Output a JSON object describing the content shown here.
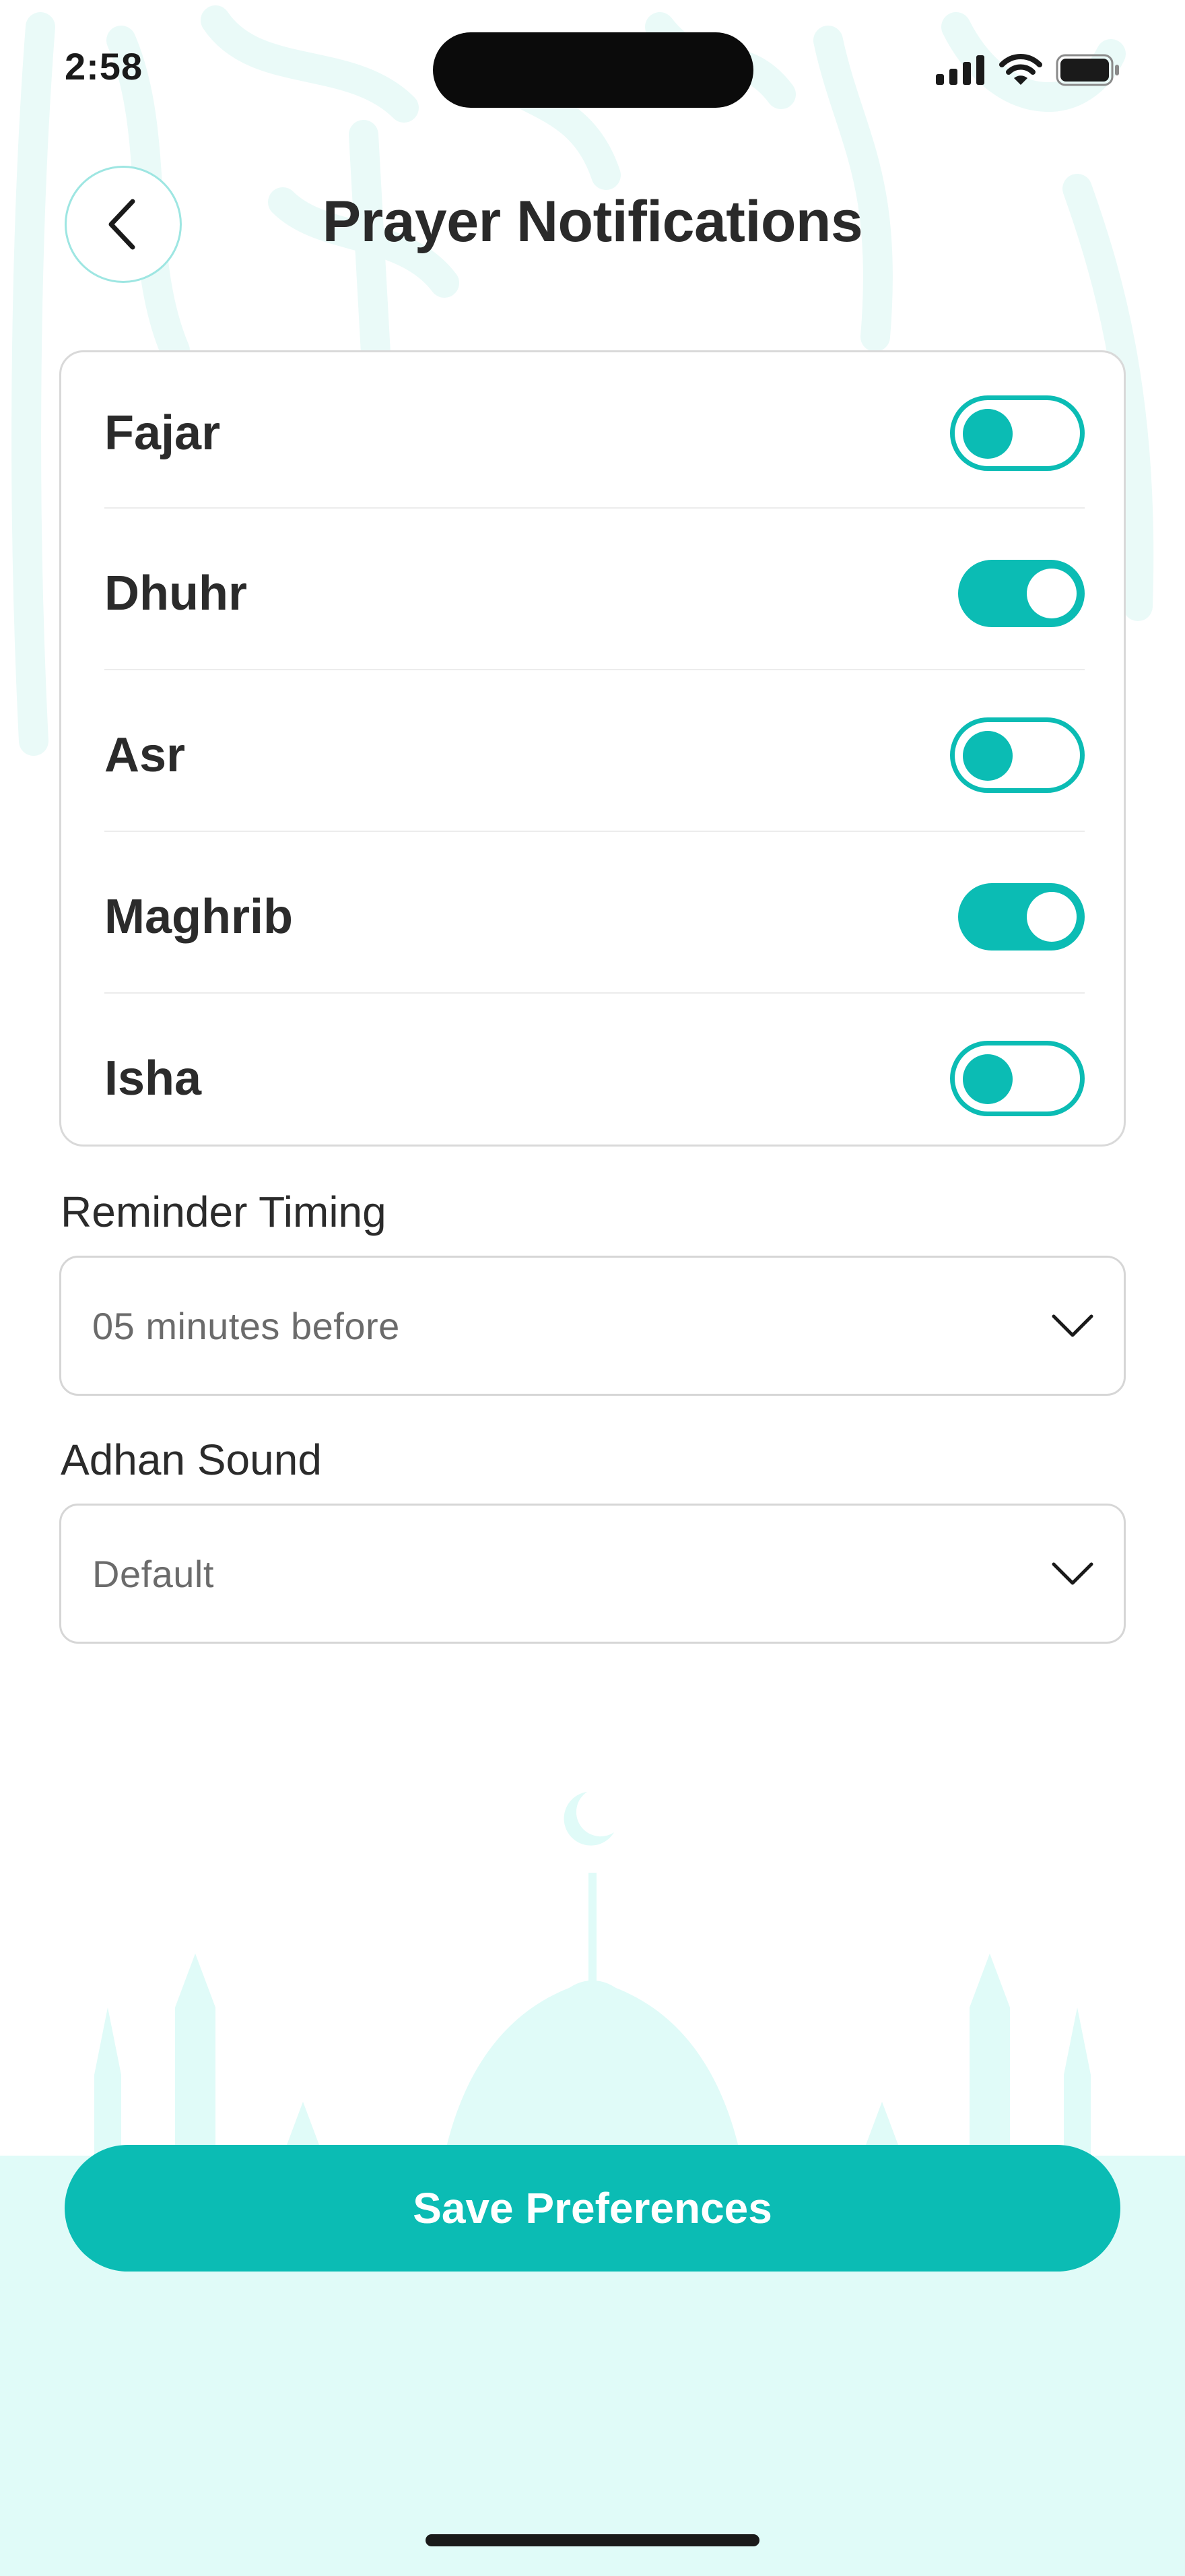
{
  "status_bar": {
    "time": "2:58",
    "icons": [
      "signal-icon",
      "wifi-icon",
      "battery-icon"
    ]
  },
  "header": {
    "back_icon": "chevron-left-icon",
    "title": "Prayer Notifications"
  },
  "prayers": [
    {
      "name": "Fajar",
      "enabled": false
    },
    {
      "name": "Dhuhr",
      "enabled": true
    },
    {
      "name": "Asr",
      "enabled": false
    },
    {
      "name": "Maghrib",
      "enabled": true
    },
    {
      "name": "Isha",
      "enabled": false
    }
  ],
  "reminder_timing": {
    "label": "Reminder Timing",
    "value": "05 minutes before",
    "icon": "chevron-down-icon"
  },
  "adhan_sound": {
    "label": "Adhan Sound",
    "value": "Default",
    "icon": "chevron-down-icon"
  },
  "save_button": {
    "label": "Save Preferences"
  },
  "colors": {
    "accent": "#0bbcb4",
    "background_tint": "#e0fbf8",
    "text": "#2b2b2b"
  }
}
